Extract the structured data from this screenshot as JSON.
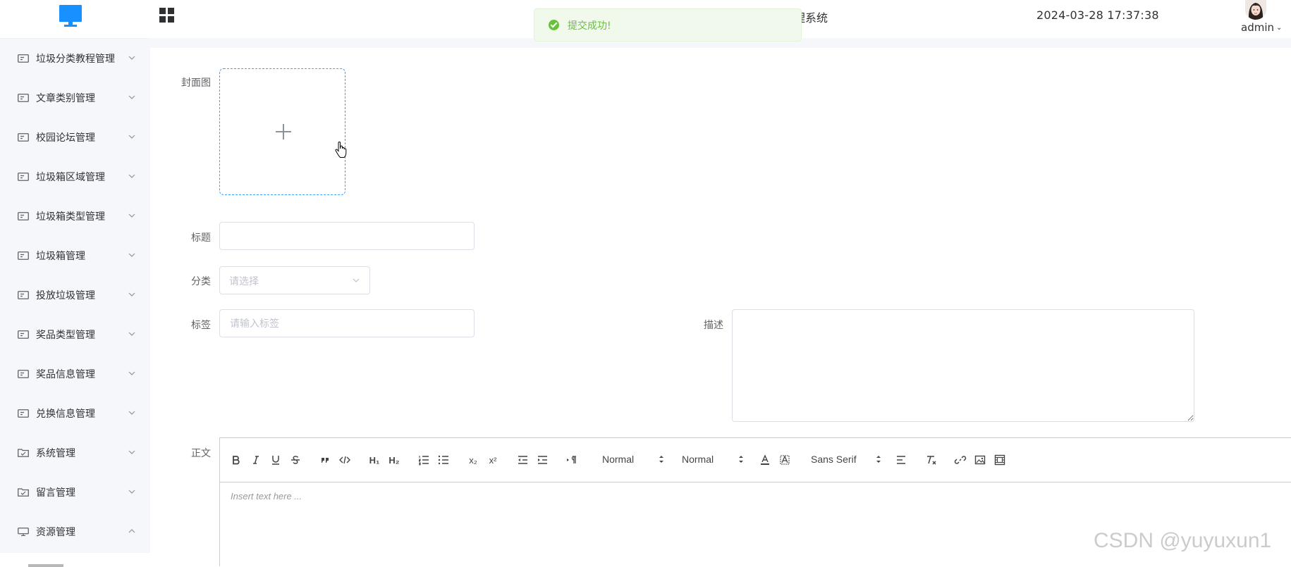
{
  "header": {
    "system_title_fragment": "理系统",
    "datetime": "2024-03-28 17:37:38",
    "user_name": "admin"
  },
  "toast": {
    "message": "提交成功!",
    "type": "success",
    "color": "#67c23a"
  },
  "sidebar": {
    "items": [
      {
        "label": "垃圾分类教程管理",
        "icon": "menu-card-icon",
        "expanded": false
      },
      {
        "label": "文章类别管理",
        "icon": "menu-card-icon",
        "expanded": false
      },
      {
        "label": "校园论坛管理",
        "icon": "menu-card-icon",
        "expanded": false
      },
      {
        "label": "垃圾箱区域管理",
        "icon": "menu-card-icon",
        "expanded": false
      },
      {
        "label": "垃圾箱类型管理",
        "icon": "menu-card-icon",
        "expanded": false
      },
      {
        "label": "垃圾箱管理",
        "icon": "menu-card-icon",
        "expanded": false
      },
      {
        "label": "投放垃圾管理",
        "icon": "menu-card-icon",
        "expanded": false
      },
      {
        "label": "奖品类型管理",
        "icon": "menu-card-icon",
        "expanded": false
      },
      {
        "label": "奖品信息管理",
        "icon": "menu-card-icon",
        "expanded": false
      },
      {
        "label": "兑换信息管理",
        "icon": "menu-card-icon",
        "expanded": false
      },
      {
        "label": "系统管理",
        "icon": "folder-check-icon",
        "expanded": false
      },
      {
        "label": "留言管理",
        "icon": "folder-check-icon",
        "expanded": false
      },
      {
        "label": "资源管理",
        "icon": "monitor-icon",
        "expanded": true
      }
    ]
  },
  "form": {
    "cover_label": "封面图",
    "title_label": "标题",
    "title_value": "",
    "category_label": "分类",
    "category_placeholder": "请选择",
    "tags_label": "标签",
    "tags_placeholder": "请输入标签",
    "description_label": "描述",
    "description_value": "",
    "content_label": "正文"
  },
  "editor": {
    "size_select": "Normal",
    "header_select": "Normal",
    "font_select": "Sans Serif",
    "placeholder": "Insert text here ..."
  },
  "watermark": "CSDN @yuyuxun1",
  "colors": {
    "primary": "#409eff",
    "sidebar_bg": "#f5f7fb",
    "success": "#67c23a"
  }
}
